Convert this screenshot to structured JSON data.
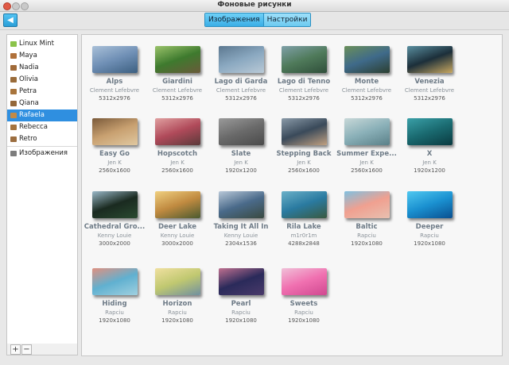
{
  "window": {
    "title": "Фоновые рисунки"
  },
  "tabs": [
    {
      "label": "Изображения",
      "active": true
    },
    {
      "label": "Настройки",
      "active": false
    }
  ],
  "sidebar": {
    "items": [
      {
        "label": "Linux Mint",
        "icon": "mint-icon",
        "color": "#8bc34a"
      },
      {
        "label": "Maya",
        "icon": "folder-image-icon",
        "color": "#b0713a"
      },
      {
        "label": "Nadia",
        "icon": "folder-image-icon",
        "color": "#a06a38"
      },
      {
        "label": "Olivia",
        "icon": "folder-image-icon",
        "color": "#9a6c3a"
      },
      {
        "label": "Petra",
        "icon": "folder-image-icon",
        "color": "#a8743c"
      },
      {
        "label": "Qiana",
        "icon": "folder-image-icon",
        "color": "#94683a"
      },
      {
        "label": "Rafaela",
        "icon": "folder-image-icon",
        "color": "#c08a48",
        "selected": true
      },
      {
        "label": "Rebecca",
        "icon": "folder-image-icon",
        "color": "#a6743e"
      },
      {
        "label": "Retro",
        "icon": "retro-icon",
        "color": "#9c6e40"
      },
      {
        "label": "Изображения",
        "icon": "pictures-folder-icon",
        "color": "#7d7d7d"
      }
    ],
    "add_label": "+",
    "remove_label": "−"
  },
  "wallpapers": [
    {
      "name": "Alps",
      "author": "Clement Lefebvre",
      "res": "5312x2976",
      "colors": [
        "#6f8fb5",
        "#a9c0d8",
        "#3c5f80"
      ]
    },
    {
      "name": "Giardini",
      "author": "Clement Lefebvre",
      "res": "5312x2976",
      "colors": [
        "#3e7a2e",
        "#9ac36a",
        "#6a5a3a"
      ]
    },
    {
      "name": "Lago di Garda",
      "author": "Clement Lefebvre",
      "res": "5312x2976",
      "colors": [
        "#8aa8c0",
        "#5c7890",
        "#b9c9d6"
      ]
    },
    {
      "name": "Lago di Tenno",
      "author": "Clement Lefebvre",
      "res": "5312x2976",
      "colors": [
        "#4f7a5a",
        "#7fa0a8",
        "#2f4e3a"
      ]
    },
    {
      "name": "Monte",
      "author": "Clement Lefebvre",
      "res": "5312x2976",
      "colors": [
        "#3f6a8a",
        "#6a8f5a",
        "#2c3f30"
      ]
    },
    {
      "name": "Venezia",
      "author": "Clement Lefebvre",
      "res": "5312x2976",
      "colors": [
        "#1c2f3a",
        "#5a8fa0",
        "#c9a860"
      ]
    },
    {
      "name": "Easy Go",
      "author": "Jen K",
      "res": "2560x1600",
      "colors": [
        "#c8a070",
        "#7a5a3a",
        "#e0c8a0"
      ]
    },
    {
      "name": "Hopscotch",
      "author": "Jen K",
      "res": "2560x1600",
      "colors": [
        "#b04a5a",
        "#e0a0a0",
        "#5a3a3a"
      ]
    },
    {
      "name": "Slate",
      "author": "Jen K",
      "res": "1920x1200",
      "colors": [
        "#6a6a6a",
        "#9a9a9a",
        "#4a4a4a"
      ]
    },
    {
      "name": "Stepping Back",
      "author": "Jen K",
      "res": "2560x1600",
      "colors": [
        "#3a4a5a",
        "#8a9aa8",
        "#c0a080"
      ]
    },
    {
      "name": "Summer Expe...",
      "author": "Jen K",
      "res": "2560x1600",
      "colors": [
        "#8ab0b8",
        "#c8d8d8",
        "#5a8088"
      ]
    },
    {
      "name": "X",
      "author": "Jen K",
      "res": "1920x1200",
      "colors": [
        "#1a6a70",
        "#3aa0a8",
        "#0a3a40"
      ]
    },
    {
      "name": "Cathedral Gro...",
      "author": "Kenny Louie",
      "res": "3000x2000",
      "colors": [
        "#1a2a20",
        "#9ab8c8",
        "#2a4a30"
      ]
    },
    {
      "name": "Deer Lake",
      "author": "Kenny Louie",
      "res": "3000x2000",
      "colors": [
        "#c08a40",
        "#f0d080",
        "#4a5a30"
      ]
    },
    {
      "name": "Taking It All In",
      "author": "Kenny Louie",
      "res": "2304x1536",
      "colors": [
        "#4a6a8a",
        "#b8c8d8",
        "#3a4a40"
      ]
    },
    {
      "name": "Rila Lake",
      "author": "m1r0r1m",
      "res": "4288x2848",
      "colors": [
        "#2a7aa0",
        "#6ab0c8",
        "#3a5a40"
      ]
    },
    {
      "name": "Baltic",
      "author": "Rapciu",
      "res": "1920x1080",
      "colors": [
        "#f0a090",
        "#80c0e0",
        "#e8c0b0"
      ]
    },
    {
      "name": "Deeper",
      "author": "Rapciu",
      "res": "1920x1080",
      "colors": [
        "#1a90d0",
        "#50c8f0",
        "#0a5090"
      ]
    },
    {
      "name": "Hiding",
      "author": "Rapciu",
      "res": "1920x1080",
      "colors": [
        "#60b0d0",
        "#e09080",
        "#a0d0e0"
      ]
    },
    {
      "name": "Horizon",
      "author": "Rapciu",
      "res": "1920x1080",
      "colors": [
        "#c0c870",
        "#f0e0a0",
        "#7090a0"
      ]
    },
    {
      "name": "Pearl",
      "author": "Rapciu",
      "res": "1920x1080",
      "colors": [
        "#2a2a5a",
        "#c07090",
        "#4a3a6a"
      ]
    },
    {
      "name": "Sweets",
      "author": "Rapciu",
      "res": "1920x1080",
      "colors": [
        "#f070b0",
        "#f0c0d8",
        "#d04890"
      ]
    }
  ]
}
